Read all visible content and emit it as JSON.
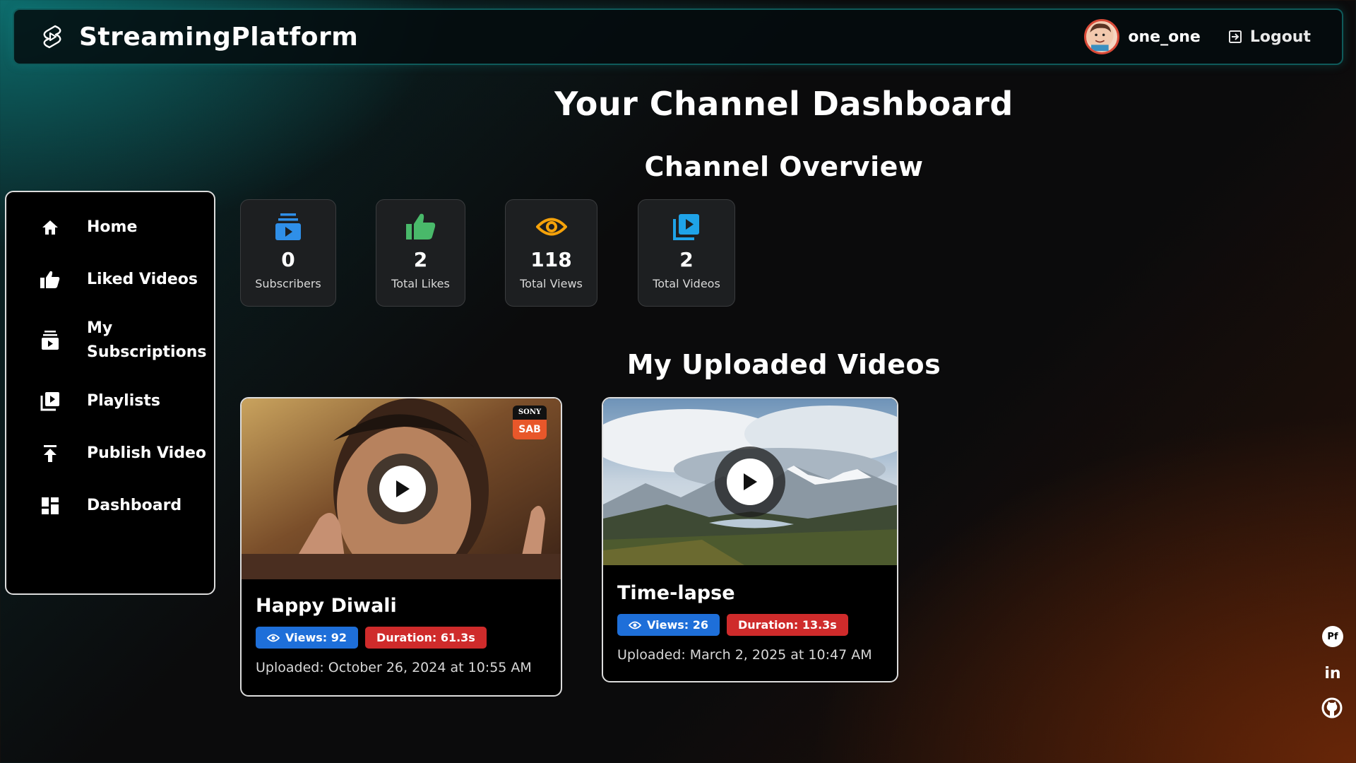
{
  "app": {
    "brand": "StreamingPlatform"
  },
  "header": {
    "username": "one_one",
    "logout_label": "Logout"
  },
  "page": {
    "title": "Your Channel Dashboard"
  },
  "overview": {
    "title": "Channel Overview",
    "stats": [
      {
        "icon": "subscriptions-icon",
        "value": "0",
        "label": "Subscribers",
        "color": "#2f8fe8"
      },
      {
        "icon": "thumbs-up-icon",
        "value": "2",
        "label": "Total Likes",
        "color": "#49b96a"
      },
      {
        "icon": "eye-icon",
        "value": "118",
        "label": "Total Views",
        "color": "#f5a20a"
      },
      {
        "icon": "video-library-icon",
        "value": "2",
        "label": "Total Videos",
        "color": "#1fa3e8"
      }
    ]
  },
  "sidebar": {
    "items": [
      {
        "label": "Home",
        "icon": "home-icon"
      },
      {
        "label": "Liked Videos",
        "icon": "thumbs-up-icon"
      },
      {
        "label": "My Subscriptions",
        "icon": "subscriptions-icon"
      },
      {
        "label": "Playlists",
        "icon": "playlist-icon"
      },
      {
        "label": "Publish Video",
        "icon": "upload-icon"
      },
      {
        "label": "Dashboard",
        "icon": "dashboard-icon"
      }
    ]
  },
  "uploads": {
    "title": "My Uploaded Videos",
    "videos": [
      {
        "title": "Happy Diwali",
        "views": "Views: 92",
        "duration": "Duration: 61.3s",
        "uploaded": "Uploaded: October 26, 2024 at 10:55 AM",
        "logo_top": "SONY",
        "logo_bottom": "SAB"
      },
      {
        "title": "Time-lapse",
        "views": "Views: 26",
        "duration": "Duration: 13.3s",
        "uploaded": "Uploaded: March 2, 2025 at 10:47 AM"
      }
    ]
  },
  "social": [
    {
      "icon": "portfolio-icon",
      "label": "Pf"
    },
    {
      "icon": "linkedin-icon",
      "label": "in"
    },
    {
      "icon": "github-icon"
    }
  ]
}
